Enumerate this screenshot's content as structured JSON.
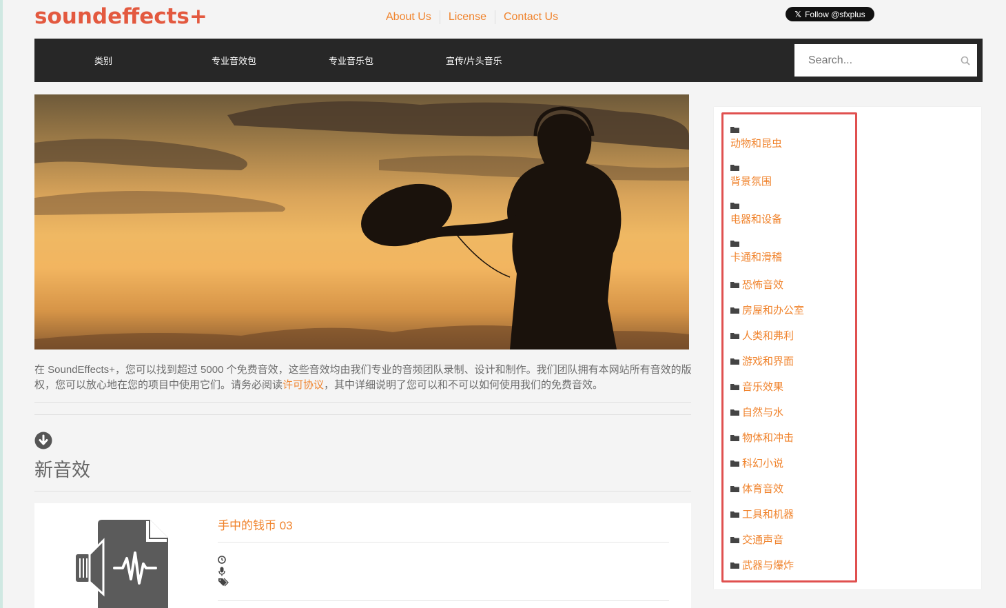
{
  "header": {
    "logo": "soundeffects+",
    "links": [
      "About Us",
      "License",
      "Contact Us"
    ],
    "follow_label": "Follow @sfxplus",
    "follow_icon": "x-logo-icon"
  },
  "nav": {
    "items": [
      "类别",
      "专业音效包",
      "专业音乐包",
      "宣传/片头音乐"
    ],
    "search_placeholder": "Search..."
  },
  "intro": {
    "text_before": "在 SoundEffects+，您可以找到超过 5000 个免费音效，这些音效均由我们专业的音频团队录制、设计和制作。我们团队拥有本网站所有音效的版权，您可以放心地在您的项目中使用它们。请务必阅读",
    "link": "许可协议",
    "text_after": "，其中详细说明了您可以和不可以如何使用我们的免费音效。"
  },
  "section": {
    "title": "新音效",
    "icon": "arrow-down-circle-icon"
  },
  "card": {
    "title": "手中的钱币 03",
    "icons": [
      "clock-icon",
      "microphone-icon",
      "tags-icon"
    ]
  },
  "sidebar": {
    "categories": [
      "动物和昆虫",
      "背景氛围",
      "电器和设备",
      "卡通和滑稽",
      "恐怖音效",
      "房屋和办公室",
      "人类和弗利",
      "游戏和界面",
      "音乐效果",
      "自然与水",
      "物体和冲击",
      "科幻小说",
      "体育音效",
      "工具和机器",
      "交通声音",
      "武器与爆炸"
    ]
  },
  "colors": {
    "accent": "#f0832c",
    "logo": "#e3593f",
    "nav_bg": "#272727",
    "highlight": "#e0504f"
  }
}
